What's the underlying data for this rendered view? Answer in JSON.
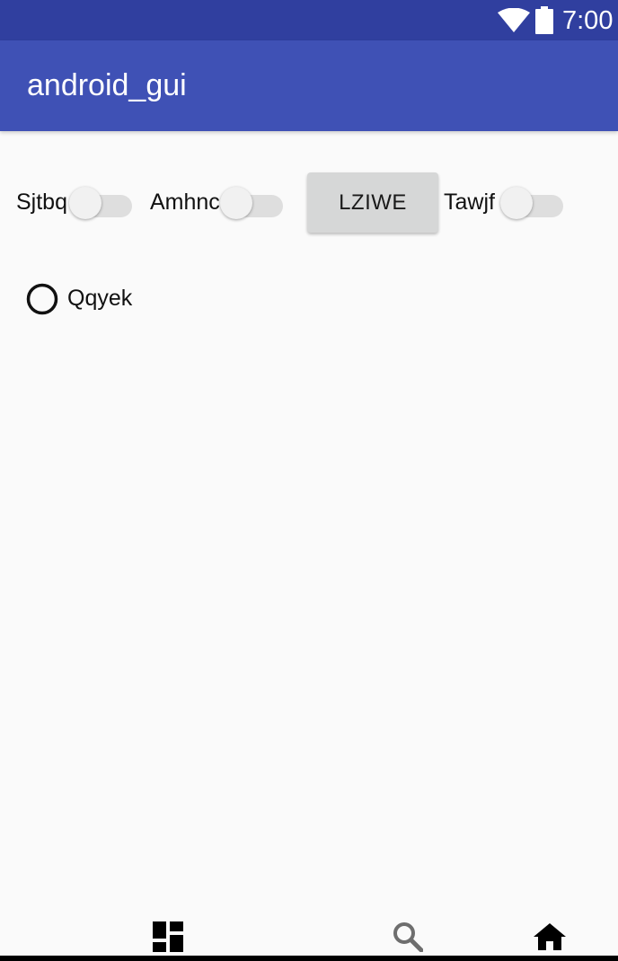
{
  "status_bar": {
    "time": "7:00",
    "icons": [
      "wifi-icon",
      "battery-icon"
    ],
    "color": "#303f9f"
  },
  "app_bar": {
    "title": "android_gui",
    "color": "#3f51b5"
  },
  "controls": {
    "switch_1": {
      "label": "Sjtbq",
      "checked": false
    },
    "switch_2": {
      "label": "Amhnc",
      "checked": false
    },
    "button": {
      "label": "LZIWE"
    },
    "switch_3": {
      "label": "Tawjf",
      "checked": false
    },
    "radio": {
      "label": "Qqyek",
      "checked": false
    }
  },
  "bottom_nav": {
    "icons": [
      "dashboard-icon",
      "search-icon",
      "home-icon"
    ]
  }
}
